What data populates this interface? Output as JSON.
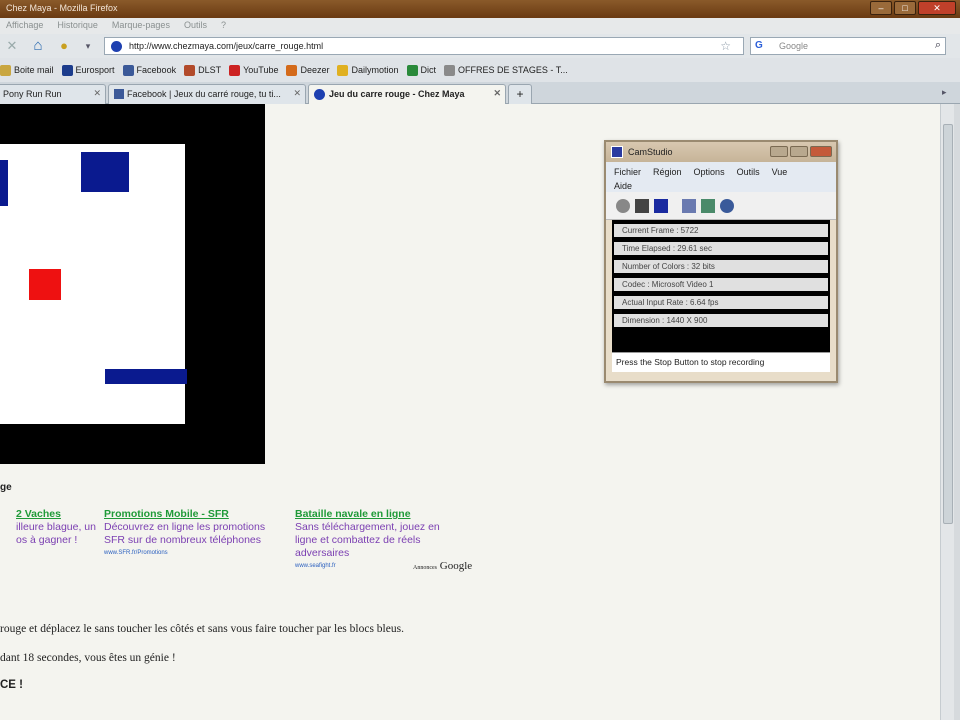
{
  "window": {
    "title": "Chez Maya - Mozilla Firefox"
  },
  "menu": [
    "Affichage",
    "Historique",
    "Marque-pages",
    "Outils",
    "?"
  ],
  "nav": {
    "url": "http://www.chezmaya.com/jeux/carre_rouge.html",
    "search_placeholder": "Google"
  },
  "bookmarks": [
    {
      "label": "Boite mail",
      "color": "#c9a640"
    },
    {
      "label": "Eurosport",
      "color": "#1c3c8c"
    },
    {
      "label": "Facebook",
      "color": "#3b5998"
    },
    {
      "label": "DLST",
      "color": "#b24a2a"
    },
    {
      "label": "YouTube",
      "color": "#cc2222"
    },
    {
      "label": "Deezer",
      "color": "#d46a1a"
    },
    {
      "label": "Dailymotion",
      "color": "#e0b020"
    },
    {
      "label": "Dict",
      "color": "#2a8a3a"
    },
    {
      "label": "OFFRES DE STAGES - T...",
      "color": "#8a8a8a"
    }
  ],
  "tabs": [
    {
      "label": "Pony Run Run",
      "active": false
    },
    {
      "label": "Facebook | Jeux du carré rouge, tu ti...",
      "active": false
    },
    {
      "label": "Jeu du carre rouge - Chez Maya",
      "active": true
    }
  ],
  "colors": {
    "red_square": "#ee1111",
    "blue_block": "#0a1a8f"
  },
  "page": {
    "game_heading": "ge",
    "ads": [
      {
        "title": "2 Vaches",
        "body": [
          "illeure blague, un",
          "os à gagner !"
        ],
        "url": ""
      },
      {
        "title": "Promotions Mobile - SFR",
        "body": [
          "Découvrez en ligne les promotions",
          "SFR sur de nombreux téléphones"
        ],
        "url": "www.SFR.fr/Promotions"
      },
      {
        "title": "Bataille navale en ligne",
        "body": [
          "Sans téléchargement, jouez en",
          "ligne et combattez de réels",
          "adversaires"
        ],
        "url": "www.seafight.fr"
      }
    ],
    "google_prefix": "Annonces",
    "google_name": "Google",
    "para1": "rouge et déplacez le sans toucher les côtés et sans vous faire toucher par les blocs bleus.",
    "para2": "dant 18 secondes, vous êtes un génie !",
    "para3": "CE !"
  },
  "camstudio": {
    "title": "CamStudio",
    "menu": [
      "Fichier",
      "Région",
      "Options",
      "Outils",
      "Vue",
      "Aide"
    ],
    "stats": [
      "Current Frame : 5722",
      "Time Elapsed : 29.61 sec",
      "Number of Colors : 32 bits",
      "Codec : Microsoft Video 1",
      "Actual Input Rate : 6.64 fps",
      "Dimension : 1440 X 900"
    ],
    "status": "Press the Stop Button to stop recording"
  }
}
